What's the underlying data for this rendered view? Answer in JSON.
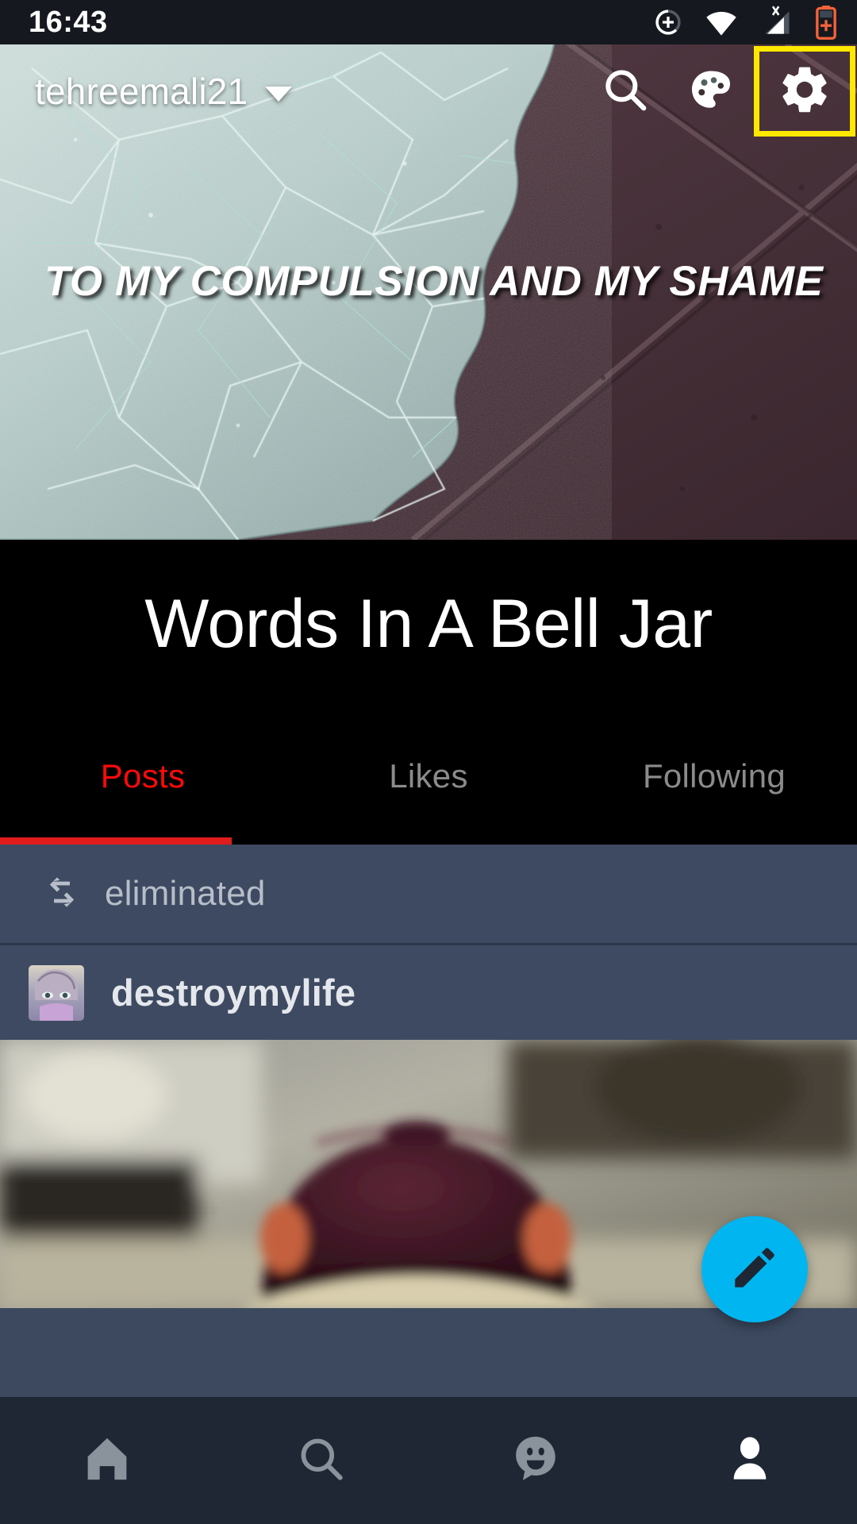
{
  "statusbar": {
    "time": "16:43",
    "icons": [
      "add-circle-icon",
      "wifi-icon",
      "no-sim-signal-icon",
      "battery-charging-icon"
    ]
  },
  "appbar": {
    "username": "tehreemali21",
    "caret": "chevron-down-icon",
    "actions": [
      {
        "name": "search-icon",
        "label": "Search"
      },
      {
        "name": "palette-icon",
        "label": "Customize"
      },
      {
        "name": "gear-icon",
        "label": "Settings",
        "highlighted": true
      }
    ],
    "highlight_color": "#ffe800"
  },
  "banner": {
    "overlay_text": "TO MY COMPULSION AND MY SHAME",
    "image_description": "shattered-glass-on-pavement"
  },
  "blog": {
    "title": "Words In A Bell Jar"
  },
  "tabs": {
    "items": [
      {
        "label": "Posts",
        "active": true
      },
      {
        "label": "Likes",
        "active": false
      },
      {
        "label": "Following",
        "active": false
      }
    ],
    "active_color": "#ff0a0a",
    "inactive_color": "#8b8b8b"
  },
  "feed": {
    "reblog": {
      "icon": "reblog-icon",
      "label": "eliminated"
    },
    "author": {
      "avatar": "avatar-thumbnail",
      "name": "destroymylife"
    },
    "post_image": "blurred-person-wearing-dark-cap"
  },
  "fab": {
    "icon": "pencil-icon",
    "label": "Create post",
    "color": "#00b5f0"
  },
  "bottomnav": {
    "items": [
      {
        "name": "home-icon",
        "label": "Home",
        "active": false
      },
      {
        "name": "search-icon",
        "label": "Explore",
        "active": false
      },
      {
        "name": "chat-smiley-icon",
        "label": "Inbox",
        "active": false
      },
      {
        "name": "account-icon",
        "label": "Account",
        "active": true
      }
    ],
    "background": "#1e2733",
    "active_color": "#ffffff",
    "inactive_color": "#8a929c"
  }
}
